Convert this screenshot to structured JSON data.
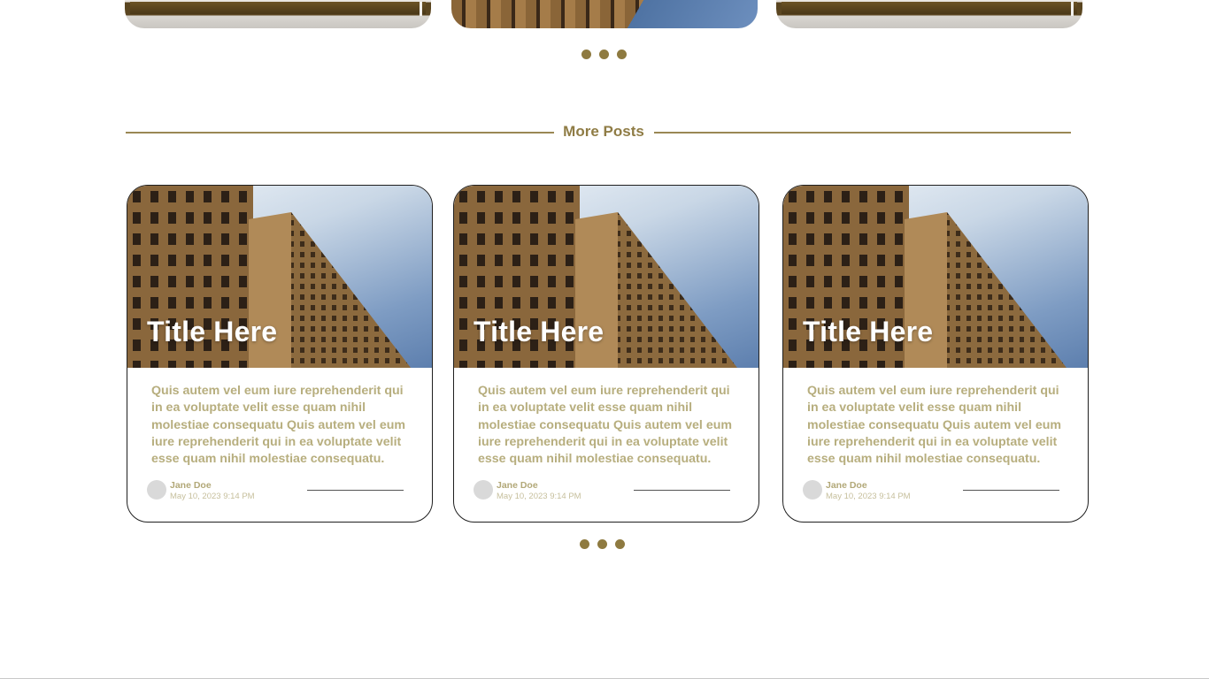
{
  "top_carousel": {
    "pagination": [
      "page-1",
      "page-2",
      "page-3"
    ]
  },
  "section": {
    "title": "More Posts",
    "accent_color": "#8e7a40"
  },
  "posts": [
    {
      "title": "Title Here",
      "excerpt": "Quis autem vel eum iure reprehenderit qui in ea voluptate velit esse quam nihil molestiae consequatu Quis autem vel eum iure reprehenderit qui in ea voluptate velit esse quam nihil molestiae consequatu.",
      "author": "Jane Doe",
      "date": "May 10, 2023 9:14 PM"
    },
    {
      "title": "Title Here",
      "excerpt": "Quis autem vel eum iure reprehenderit qui in ea voluptate velit esse quam nihil molestiae consequatu Quis autem vel eum iure reprehenderit qui in ea voluptate velit esse quam nihil molestiae consequatu.",
      "author": "Jane Doe",
      "date": "May 10, 2023 9:14 PM"
    },
    {
      "title": "Title Here",
      "excerpt": "Quis autem vel eum iure reprehenderit qui in ea voluptate velit esse quam nihil molestiae consequatu Quis autem vel eum iure reprehenderit qui in ea voluptate velit esse quam nihil molestiae consequatu.",
      "author": "Jane Doe",
      "date": "May 10, 2023 9:14 PM"
    }
  ],
  "bottom_carousel": {
    "pagination": [
      "page-1",
      "page-2",
      "page-3"
    ]
  }
}
